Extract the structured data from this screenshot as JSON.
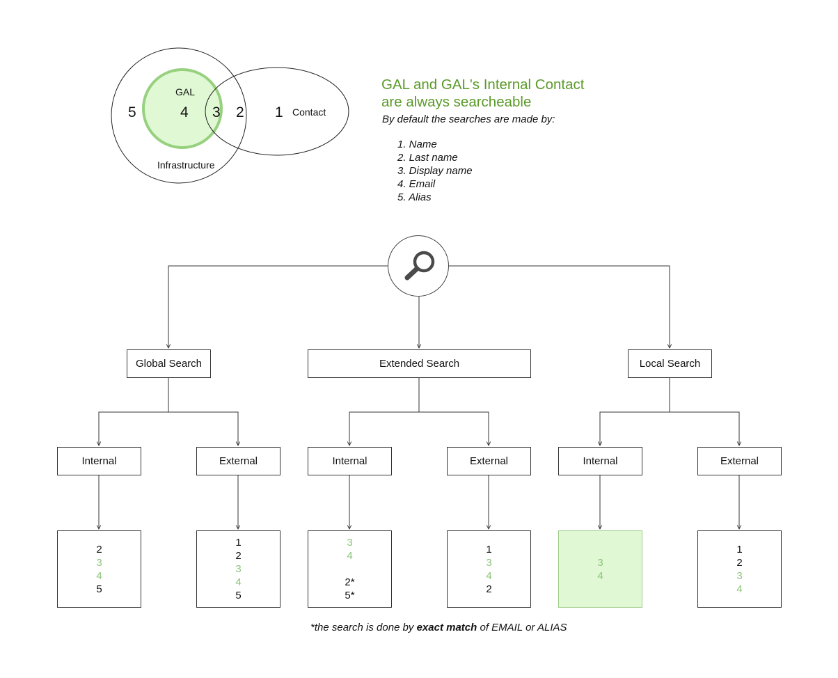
{
  "venn": {
    "sets": {
      "infrastructure": "Infrastructure",
      "gal": "GAL",
      "contact": "Contact"
    },
    "regions": [
      "5",
      "4",
      "3",
      "2",
      "1"
    ],
    "colors": {
      "gal_fill": "#e0f9d4",
      "gal_stroke": "#97d17f"
    }
  },
  "info": {
    "title_line1": "GAL and GAL's Internal Contact",
    "title_line2": "are always searcheable",
    "title_color": "#5b9a2a",
    "subtitle": "By default the searches are made by:",
    "criteria": [
      "1. Name",
      "2. Last name",
      "3. Display name",
      "4. Email",
      "5. Alias"
    ]
  },
  "root": {
    "icon": "search-icon"
  },
  "branches": [
    {
      "label": "Global Search",
      "children": [
        {
          "label": "Internal",
          "highlight": false,
          "results": [
            {
              "v": "2",
              "green": false
            },
            {
              "v": "3",
              "green": true
            },
            {
              "v": "4",
              "green": true
            },
            {
              "v": "5",
              "green": false
            }
          ]
        },
        {
          "label": "External",
          "highlight": false,
          "results": [
            {
              "v": "1",
              "green": false
            },
            {
              "v": "2",
              "green": false
            },
            {
              "v": "3",
              "green": true
            },
            {
              "v": "4",
              "green": true
            },
            {
              "v": "5",
              "green": false
            }
          ]
        }
      ]
    },
    {
      "label": "Extended Search",
      "children": [
        {
          "label": "Internal",
          "highlight": false,
          "results": [
            {
              "v": "3",
              "green": true
            },
            {
              "v": "4",
              "green": true
            },
            {
              "v": "",
              "green": false
            },
            {
              "v": "2*",
              "green": false
            },
            {
              "v": "5*",
              "green": false
            }
          ]
        },
        {
          "label": "External",
          "highlight": false,
          "results": [
            {
              "v": "1",
              "green": false
            },
            {
              "v": "3",
              "green": true
            },
            {
              "v": "4",
              "green": true
            },
            {
              "v": "2",
              "green": false
            }
          ]
        }
      ]
    },
    {
      "label": "Local Search",
      "children": [
        {
          "label": "Internal",
          "highlight": true,
          "results": [
            {
              "v": "3",
              "green": true
            },
            {
              "v": "4",
              "green": true
            }
          ]
        },
        {
          "label": "External",
          "highlight": false,
          "results": [
            {
              "v": "1",
              "green": false
            },
            {
              "v": "2",
              "green": false
            },
            {
              "v": "3",
              "green": true
            },
            {
              "v": "4",
              "green": true
            }
          ]
        }
      ]
    }
  ],
  "footnote": {
    "prefix": "*the search is done by ",
    "bold": "exact match",
    "suffix": " of EMAIL or ALIAS"
  }
}
